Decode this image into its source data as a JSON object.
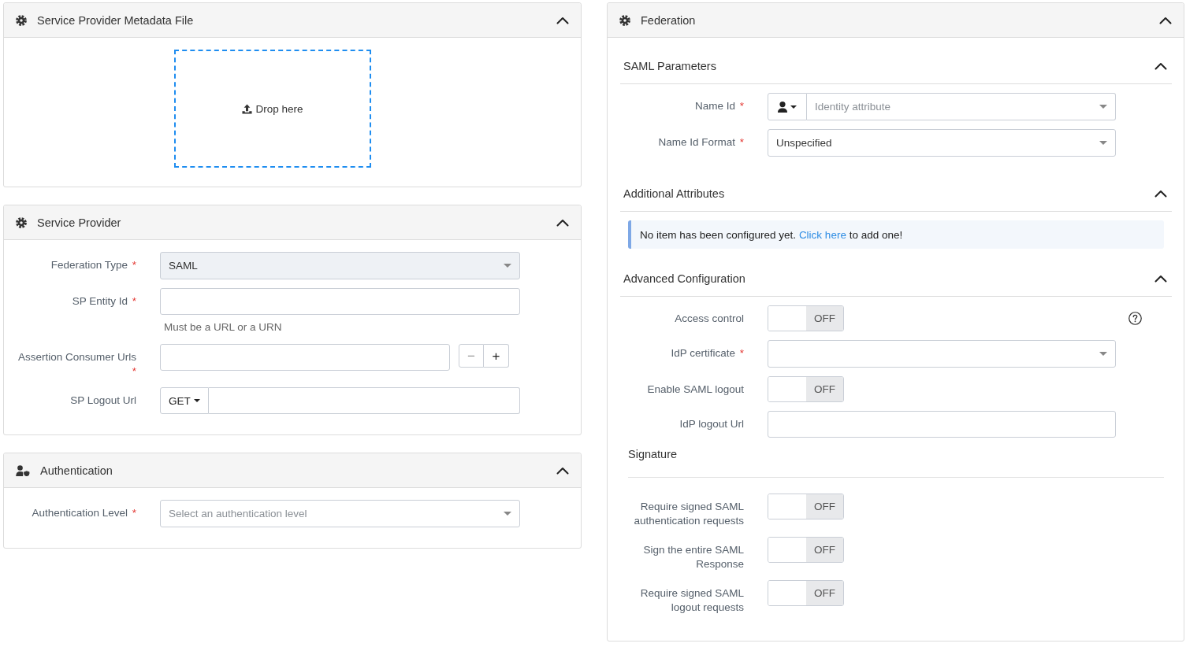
{
  "left_column": [
    {
      "kind": "dropzone",
      "title": "Service Provider Metadata File",
      "expanded": true,
      "drop_label": "Drop here"
    },
    {
      "kind": "form",
      "title": "Service Provider",
      "expanded": true,
      "fields": [
        {
          "kind": "select",
          "label": "Federation Type",
          "required_mark": "*",
          "value": "SAML",
          "disabled": true
        },
        {
          "kind": "text",
          "label": "SP Entity Id",
          "required_mark": "*",
          "help_text": "Must be a URL or a URN"
        },
        {
          "kind": "list",
          "label": "Assertion Consumer Urls",
          "required_mark": "*",
          "buttons": [
            {
              "label": "−",
              "disabled": true
            },
            {
              "label": "+",
              "disabled": false
            }
          ]
        },
        {
          "kind": "method-url",
          "label": "SP Logout Url",
          "method": "GET"
        }
      ]
    },
    {
      "kind": "form",
      "title": "Authentication",
      "expanded": true,
      "fields": [
        {
          "kind": "select",
          "label": "Authentication Level",
          "required_mark": "*",
          "placeholder": "Select an authentication level",
          "disabled": false
        }
      ]
    }
  ],
  "right_column": [
    {
      "kind": "sections",
      "title": "Federation",
      "expanded": true,
      "sections": [
        {
          "kind": "fields",
          "title": "SAML Parameters",
          "expanded": true,
          "fields": [
            {
              "kind": "attribute-select",
              "label": "Name Id",
              "required_mark": "*",
              "placeholder": "Identity attribute"
            },
            {
              "kind": "select",
              "label": "Name Id Format",
              "required_mark": "*",
              "value": "Unspecified",
              "disabled": false
            }
          ]
        },
        {
          "kind": "alert",
          "title": "Additional Attributes",
          "expanded": true,
          "message": {
            "before": "No item has been configured yet.",
            "link": "Click here",
            "after": "to add one!"
          }
        },
        {
          "kind": "fields",
          "title": "Advanced Configuration",
          "expanded": true,
          "fields": [
            {
              "kind": "toggle",
              "label": "Access control",
              "on": false,
              "state_label": "OFF",
              "help": true
            },
            {
              "kind": "select",
              "label": "IdP certificate",
              "required_mark": "*",
              "disabled": false
            },
            {
              "kind": "toggle",
              "label": "Enable SAML logout",
              "on": false,
              "state_label": "OFF"
            },
            {
              "kind": "text",
              "label": "IdP logout Url"
            }
          ],
          "subsections": [
            {
              "title": "Signature",
              "fields": [
                {
                  "kind": "toggle",
                  "label": "Require signed SAML authentication requests",
                  "on": false,
                  "state_label": "OFF"
                },
                {
                  "kind": "toggle",
                  "label": "Sign the entire SAML Response",
                  "on": false,
                  "state_label": "OFF"
                },
                {
                  "kind": "toggle",
                  "label": "Require signed SAML logout requests",
                  "on": false,
                  "state_label": "OFF"
                }
              ]
            }
          ]
        }
      ]
    }
  ]
}
